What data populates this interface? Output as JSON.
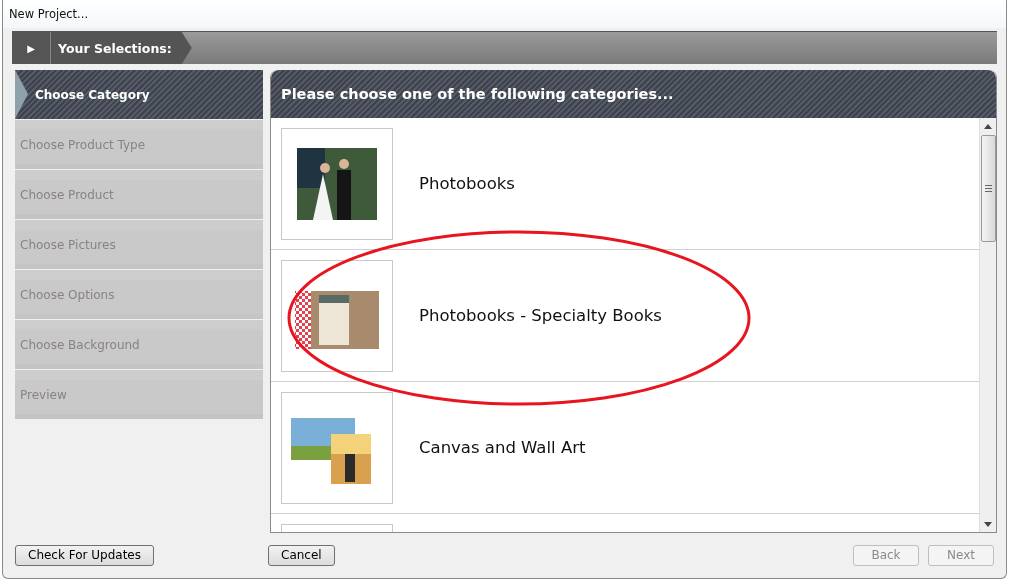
{
  "window": {
    "title": "New Project..."
  },
  "selections_bar": {
    "label": "Your Selections:",
    "arrow": "▶"
  },
  "steps": [
    {
      "label": "Choose Category",
      "selected": true
    },
    {
      "label": "Choose Product Type",
      "selected": false
    },
    {
      "label": "Choose Product",
      "selected": false
    },
    {
      "label": "Choose Pictures",
      "selected": false
    },
    {
      "label": "Choose Options",
      "selected": false
    },
    {
      "label": "Choose Background",
      "selected": false
    },
    {
      "label": "Preview",
      "selected": false
    }
  ],
  "categories": {
    "heading": "Please choose one of the following categories...",
    "items": [
      {
        "label": "Photobooks",
        "kind": "wedding"
      },
      {
        "label": "Photobooks - Specialty Books",
        "kind": "recipe"
      },
      {
        "label": "Canvas and Wall Art",
        "kind": "canvas"
      },
      {
        "kind": "blank"
      }
    ]
  },
  "buttons": [
    {
      "label": "Check For Updates",
      "disabled": false
    },
    {
      "label": "Cancel",
      "disabled": false
    },
    {
      "label": "Back",
      "disabled": true
    },
    {
      "label": "Next",
      "disabled": true
    }
  ]
}
